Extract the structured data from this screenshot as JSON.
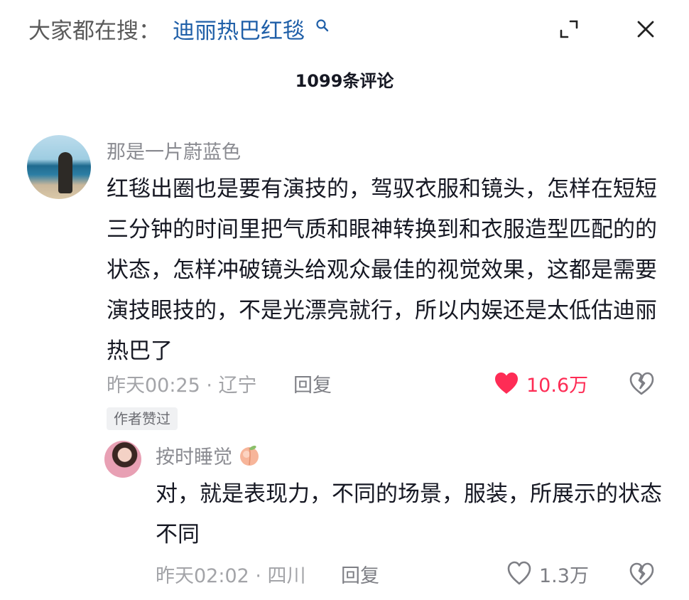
{
  "header": {
    "search_prefix": "大家都在搜：",
    "search_keyword": "迪丽热巴红毯",
    "comment_count": "1099条评论"
  },
  "comments": [
    {
      "username": "那是一片蔚蓝色",
      "text": "红毯出圈也是要有演技的，驾驭衣服和镜头，怎样在短短三分钟的时间里把气质和眼神转换到和衣服造型匹配的的状态，怎样冲破镜头给观众最佳的视觉效果，这都是需要演技眼技的，不是光漂亮就行，所以内娱还是太低估迪丽热巴了",
      "meta": "昨天00:25 · 辽宁",
      "reply_label": "回复",
      "likes": "10.6万",
      "liked": true,
      "badge": "作者赞过"
    },
    {
      "username": "按时睡觉",
      "text": "对，就是表现力，不同的场景，服装，所展示的状态不同",
      "meta": "昨天02:02 · 四川",
      "reply_label": "回复",
      "likes": "1.3万",
      "liked": false
    }
  ],
  "icons": {
    "search": "search-icon",
    "expand": "expand-icon",
    "close": "close-icon",
    "like": "heart-icon",
    "dislike": "broken-heart-icon",
    "emoji": "peach-icon"
  },
  "colors": {
    "accent_like": "#fe2c55",
    "keyword_link": "#1f5fa8"
  }
}
